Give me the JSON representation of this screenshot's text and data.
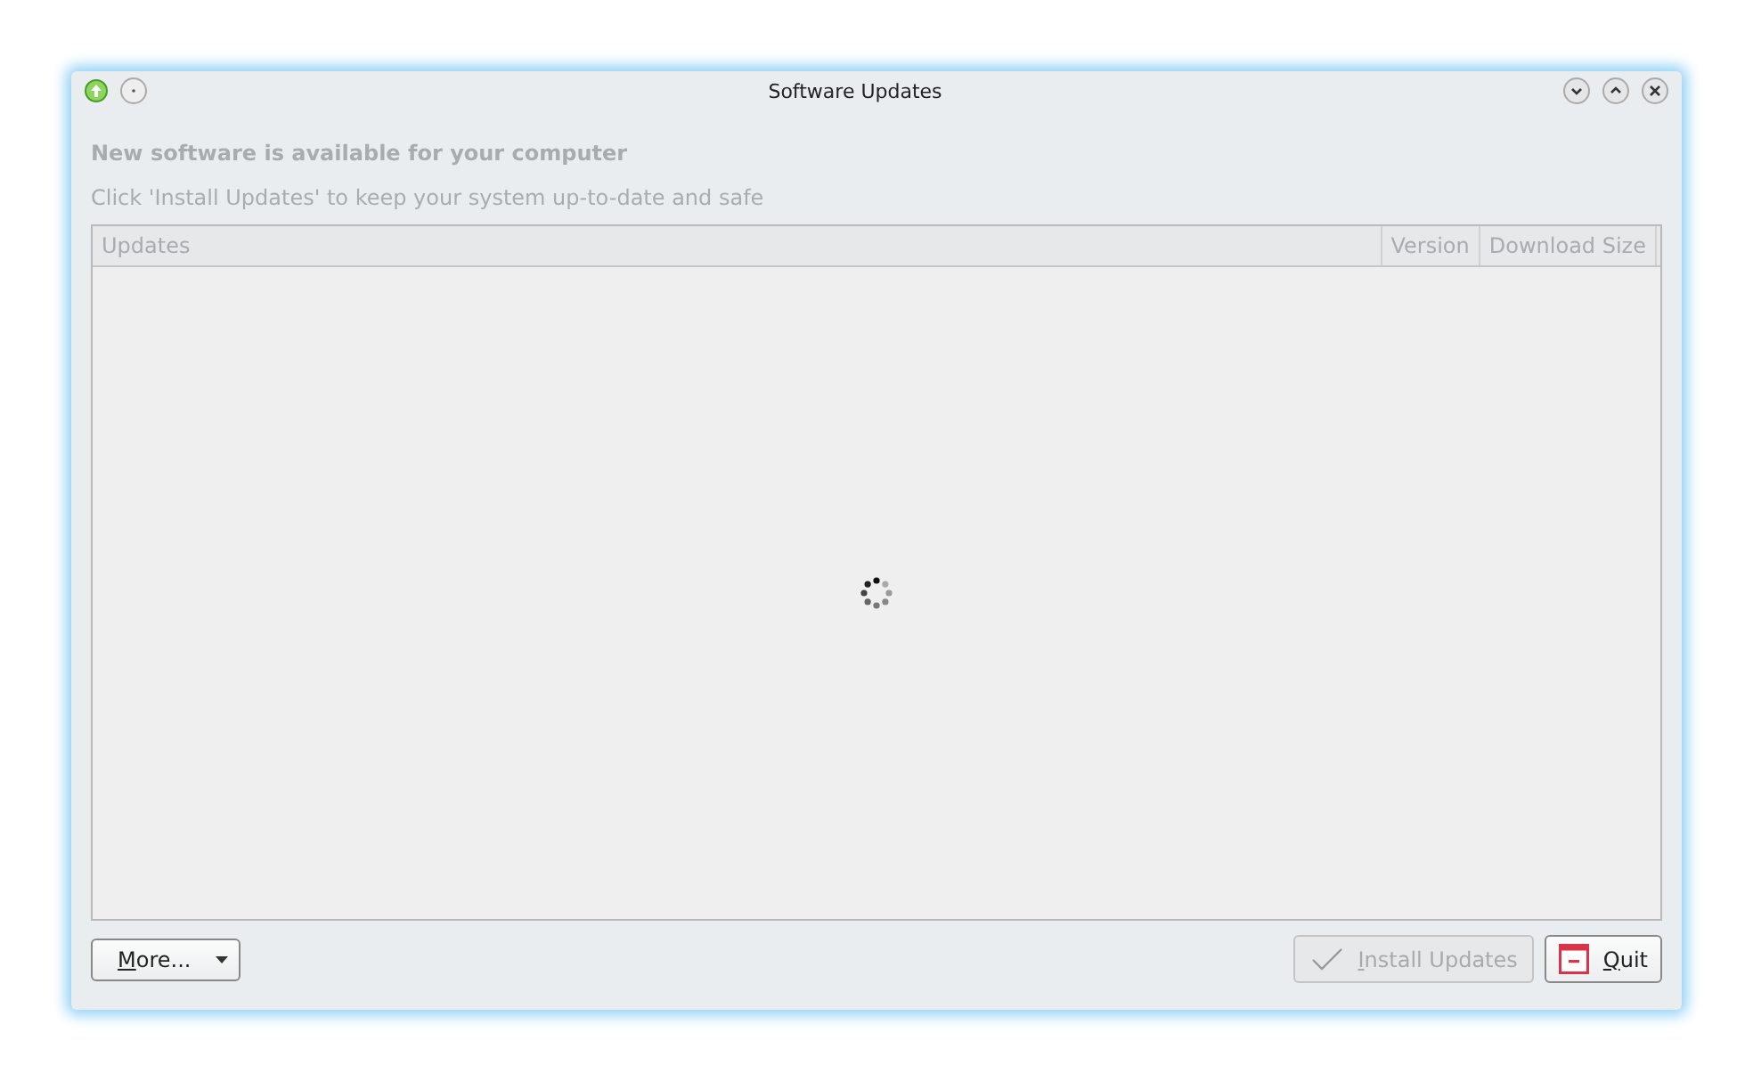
{
  "window": {
    "title": "Software Updates"
  },
  "heading": "New software is available for your computer",
  "subtitle": "Click 'Install Updates' to keep your system up-to-date and safe",
  "table": {
    "columns": [
      {
        "label": "Updates"
      },
      {
        "label": "Version"
      },
      {
        "label": "Download Size"
      }
    ],
    "loading": true
  },
  "buttons": [
    {
      "label": "More...",
      "kind": "menu",
      "disabled": false
    },
    {
      "label": "Install Updates",
      "kind": "install",
      "disabled": true
    },
    {
      "label": "Quit",
      "kind": "quit",
      "disabled": false
    }
  ]
}
